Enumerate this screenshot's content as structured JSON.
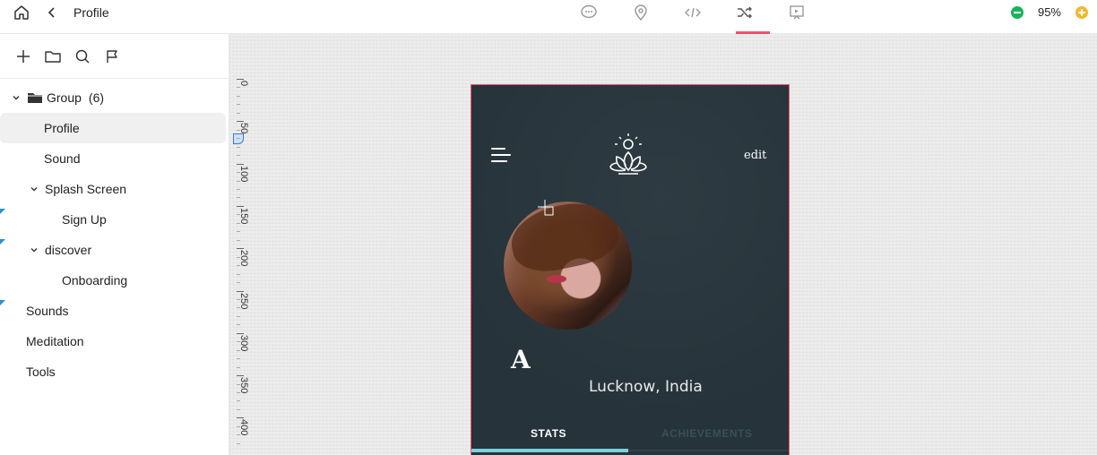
{
  "topbar": {
    "title": "Profile",
    "zoom": "95%",
    "tabs": [
      {
        "icon": "comment-icon"
      },
      {
        "icon": "location-pin-icon"
      },
      {
        "icon": "code-icon"
      },
      {
        "icon": "shuffle-icon",
        "active": true
      },
      {
        "icon": "preview-icon"
      }
    ]
  },
  "sidebar": {
    "tools": [
      "plus-icon",
      "folder-icon",
      "search-icon",
      "flag-icon"
    ],
    "tree": [
      {
        "label": "Group",
        "count": "(6)",
        "level": 0,
        "expanded": true,
        "icon": "folder-icon"
      },
      {
        "label": "Profile",
        "level": 1,
        "selected": true
      },
      {
        "label": "Sound",
        "level": 1
      },
      {
        "label": "Splash Screen",
        "level": 1,
        "expanded": true
      },
      {
        "label": "Sign Up",
        "level": 2,
        "flag": true
      },
      {
        "label": "discover",
        "level": 1,
        "expanded": true,
        "flag": true
      },
      {
        "label": "Onboarding",
        "level": 2
      },
      {
        "label": "Sounds",
        "level": 0,
        "flag": true
      },
      {
        "label": "Meditation",
        "level": 0
      },
      {
        "label": "Tools",
        "level": 0
      }
    ]
  },
  "ruler": {
    "labels": [
      "0",
      "50",
      "100",
      "150",
      "200",
      "250",
      "300",
      "350",
      "400"
    ]
  },
  "phone": {
    "edit_label": "edit",
    "name_initial": "A",
    "location": "Lucknow, India",
    "tabs": {
      "stats": "STATS",
      "achievements": "ACHIEVEMENTS"
    },
    "colors": {
      "background": "#26333a",
      "accent": "#7fd0dc",
      "frame_border": "#f0506e"
    }
  }
}
